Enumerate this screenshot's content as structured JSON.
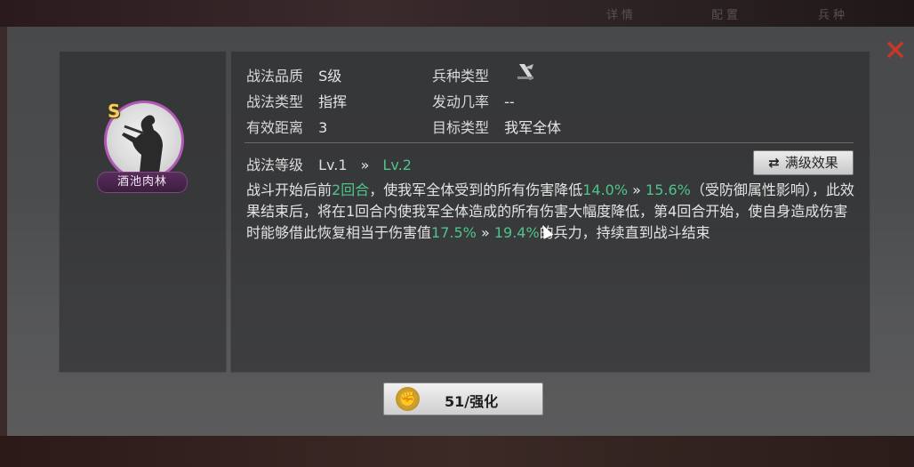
{
  "background": {
    "tabs": [
      "详情",
      "配置",
      "兵种"
    ]
  },
  "close_icon": "×",
  "tactic": {
    "grade_badge": "S",
    "name": "酒池肉林"
  },
  "info": {
    "quality_label": "战法品质",
    "quality_value": "S级",
    "unit_type_label": "兵种类型",
    "type_label": "战法类型",
    "type_value": "指挥",
    "trigger_label": "发动几率",
    "trigger_value": "--",
    "range_label": "有效距离",
    "range_value": "3",
    "target_label": "目标类型",
    "target_value": "我军全体"
  },
  "level": {
    "label": "战法等级",
    "current": "Lv.1",
    "arrow": "»",
    "next": "Lv.2"
  },
  "max_button": {
    "icon": "⇄",
    "label": "满级效果"
  },
  "description": {
    "p1": "战斗开始后前",
    "rounds": "2回合",
    "p2": "，使我军全体受到的所有伤害降低",
    "v1a": "14.0%",
    "arrow": "»",
    "v1b": "15.6%",
    "p3": "（受防御属性影响），此效果结束后，将在1回合内使我军全体造成的所有伤害大幅度降低，第4回合开始，使自身造成伤害时能够借此恢复相当于伤害值",
    "v2a": "17.5%",
    "v2b": "19.4%",
    "p4": "的兵力，持续直到战斗结束"
  },
  "enhance_button": {
    "label": "51/强化",
    "icon": "fist-icon"
  },
  "colors": {
    "accent_green": "#4fc38a",
    "close_red": "#c0392b",
    "frame_purple": "#b05ab4"
  }
}
